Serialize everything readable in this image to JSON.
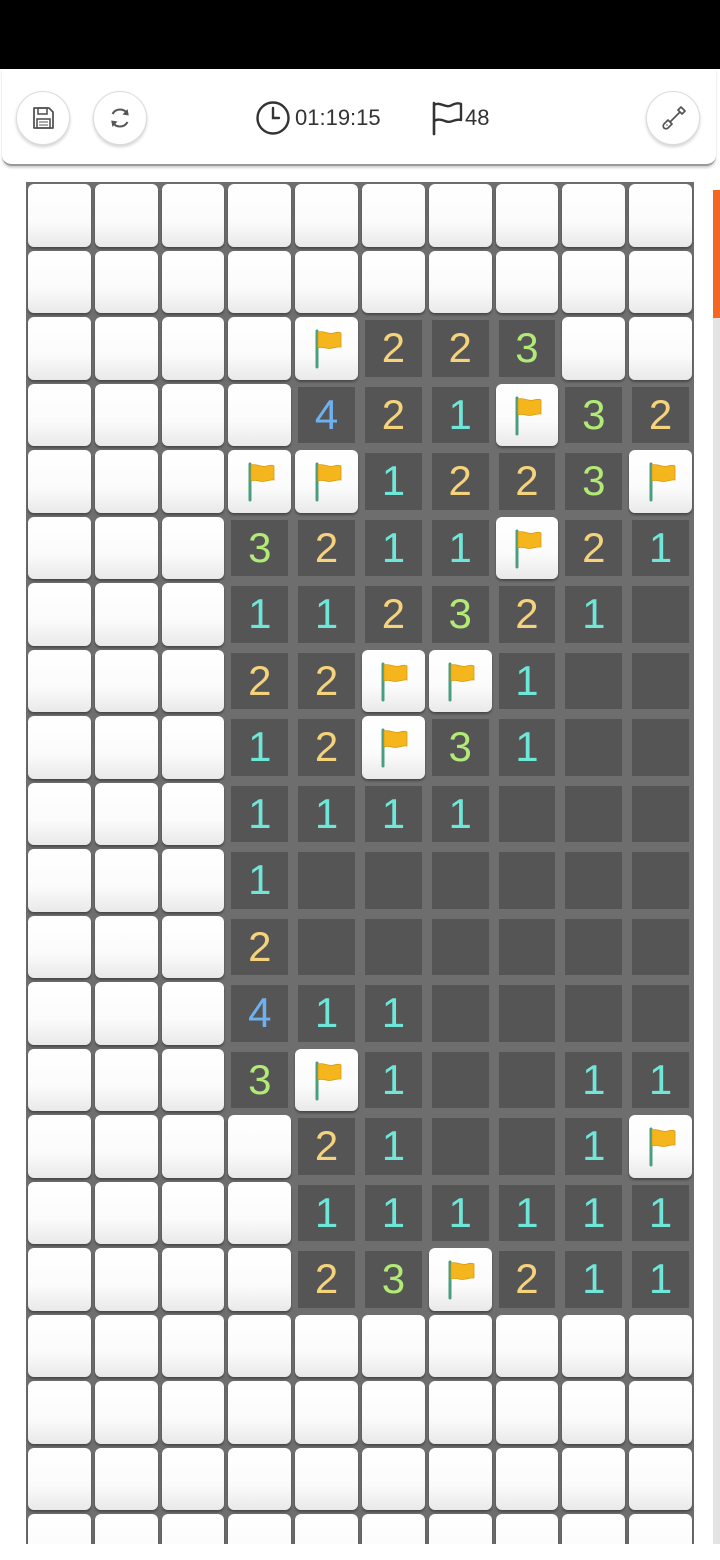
{
  "toolbar": {
    "timer": "01:19:15",
    "flags_remaining": "48",
    "icons": {
      "save": "save-icon",
      "restart": "restart-icon",
      "settings": "shovel-icon",
      "timer": "clock-icon",
      "flags": "flag-outline-icon"
    }
  },
  "board": {
    "columns": 10,
    "legend": "H = hidden, F = flagged, 0 = empty revealed, 1-4 = revealed number",
    "rows": [
      "HHHHHHHHHH",
      "HHHHHHHHHH",
      "HHHHF223HH",
      "HHHH421F32",
      "HHHFF1223F",
      "HHH3211F21",
      "HHH112321",
      "HHH22FF1",
      "HHH12F31",
      "HHH1111",
      "HHH1",
      "HHH2",
      "HHH411",
      "HHH3F1  11",
      "HHHH21  1F",
      "HHHH111111",
      "HHHH23F211",
      "HHHHHHHHHH",
      "HHHHHHHHHH",
      "HHHHHHHHHH",
      "HHHHHHHHHH"
    ],
    "number_colors": {
      "1": "#6ee6d8",
      "2": "#f5d37c",
      "3": "#b2ea76",
      "4": "#6fb1f0"
    },
    "flag_color": "#f5b51c",
    "flag_pole_color": "#4a9e7f",
    "hidden_color": "#fafafa",
    "revealed_color": "#555555",
    "grid_color": "#6e6e6e"
  },
  "scrollbar": {
    "accent": "#f26722"
  }
}
